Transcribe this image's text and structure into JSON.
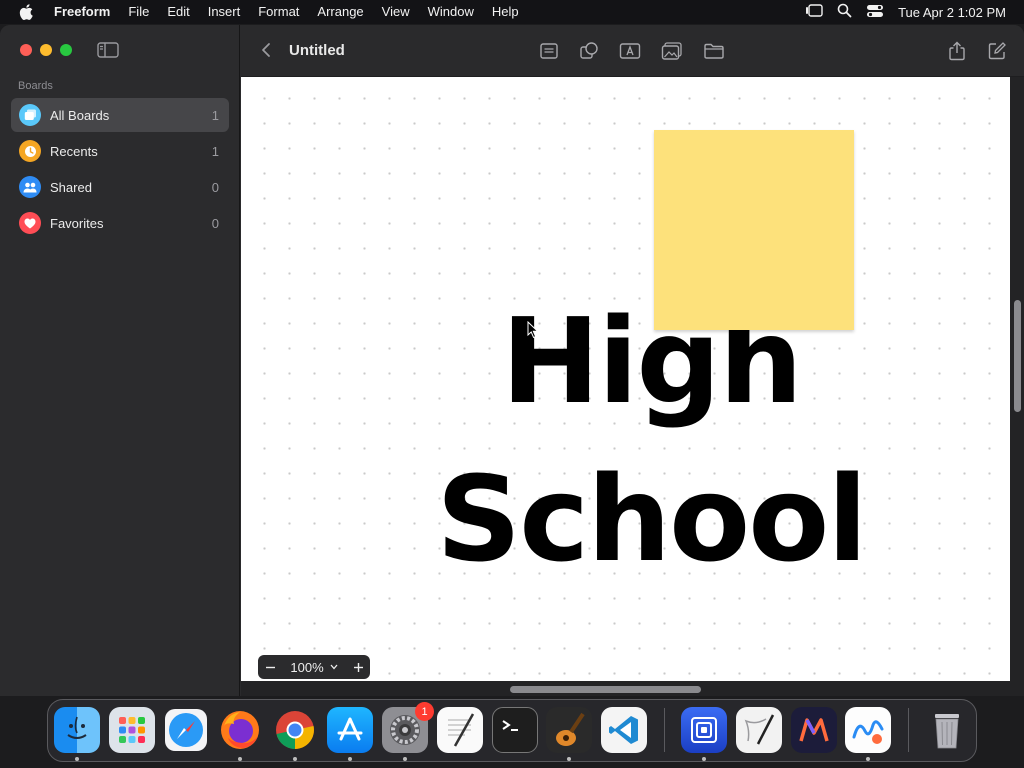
{
  "menubar": {
    "app_name": "Freeform",
    "items": [
      "File",
      "Edit",
      "Insert",
      "Format",
      "Arrange",
      "View",
      "Window",
      "Help"
    ],
    "clock": "Tue Apr 2  1:02 PM"
  },
  "sidebar": {
    "section_label": "Boards",
    "items": [
      {
        "label": "All Boards",
        "count": "1",
        "icon": "all-boards-icon",
        "color": "#5ac8fa"
      },
      {
        "label": "Recents",
        "count": "1",
        "icon": "clock-icon",
        "color": "#f5a623"
      },
      {
        "label": "Shared",
        "count": "0",
        "icon": "people-icon",
        "color": "#2f8cf4"
      },
      {
        "label": "Favorites",
        "count": "0",
        "icon": "heart-icon",
        "color": "#ff4d55"
      }
    ]
  },
  "toolbar": {
    "title": "Untitled"
  },
  "canvas": {
    "text_line1": "High",
    "text_line2": "School",
    "sticky_color": "#fde17b"
  },
  "zoom": {
    "value": "100%"
  },
  "dock": {
    "apps": [
      "finder-icon",
      "launchpad-icon",
      "safari-icon",
      "firefox-icon",
      "chrome-icon",
      "app-store-icon",
      "system-settings-icon",
      "textedit-icon",
      "terminal-icon",
      "garageband-icon",
      "vscode-icon",
      "screens-icon",
      "script-editor-icon",
      "multi-icon",
      "freeform-icon",
      "trash-icon"
    ],
    "settings_badge": "1"
  }
}
